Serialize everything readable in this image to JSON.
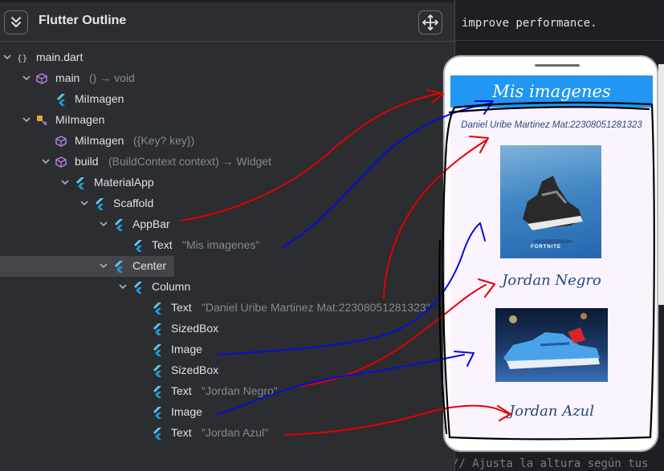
{
  "editor": {
    "top_line": "improve performance.",
    "bottom_line": "// Ajusta la altura según tus"
  },
  "panel": {
    "title": "Flutter Outline",
    "collapse_icon": "double-chevron-down-icon",
    "move_icon": "move-arrows-icon"
  },
  "tree": [
    {
      "label": "main.dart",
      "detail": "",
      "icon": "braces-icon",
      "expandable": true
    },
    {
      "label": "main",
      "detail": "() → void",
      "icon": "cube-icon",
      "expandable": true
    },
    {
      "label": "MiImagen",
      "detail": "",
      "icon": "flutter-icon",
      "expandable": false
    },
    {
      "label": "MiImagen",
      "detail": "",
      "icon": "class-icon",
      "expandable": true
    },
    {
      "label": "MiImagen",
      "detail": "({Key? key})",
      "icon": "cube-icon",
      "expandable": false
    },
    {
      "label": "build",
      "detail": "(BuildContext context) → Widget",
      "icon": "cube-icon",
      "expandable": true
    },
    {
      "label": "MaterialApp",
      "detail": "",
      "icon": "flutter-icon",
      "expandable": true
    },
    {
      "label": "Scaffold",
      "detail": "",
      "icon": "flutter-icon",
      "expandable": true
    },
    {
      "label": "AppBar",
      "detail": "",
      "icon": "flutter-icon",
      "expandable": true
    },
    {
      "label": "Text",
      "detail": "\"Mis imagenes\"",
      "icon": "flutter-icon",
      "expandable": false
    },
    {
      "label": "Center",
      "detail": "",
      "icon": "flutter-icon",
      "expandable": true,
      "selected": true
    },
    {
      "label": "Column",
      "detail": "",
      "icon": "flutter-icon",
      "expandable": true
    },
    {
      "label": "Text",
      "detail": "\"Daniel Uribe Martinez Mat:22308051281323\"",
      "icon": "flutter-icon",
      "expandable": false
    },
    {
      "label": "SizedBox",
      "detail": "",
      "icon": "flutter-icon",
      "expandable": false
    },
    {
      "label": "Image",
      "detail": "",
      "icon": "flutter-icon",
      "expandable": false
    },
    {
      "label": "SizedBox",
      "detail": "",
      "icon": "flutter-icon",
      "expandable": false
    },
    {
      "label": "Text",
      "detail": "\"Jordan Negro\"",
      "icon": "flutter-icon",
      "expandable": false
    },
    {
      "label": "Image",
      "detail": "",
      "icon": "flutter-icon",
      "expandable": false
    },
    {
      "label": "Text",
      "detail": "\"Jordan Azul\"",
      "icon": "flutter-icon",
      "expandable": false
    }
  ],
  "app": {
    "appbar_title": "Mis imagenes",
    "subtitle": "Daniel Uribe Martinez Mat:22308051281323",
    "image1_watermark": "FORTNITE",
    "caption1": "Jordan Negro",
    "caption2": "Jordan Azul",
    "appbar_color": "#2196f3",
    "caption_color": "#244a7c"
  },
  "annotations": {
    "colors": [
      "#e00000",
      "#0010d8",
      "#000000"
    ]
  }
}
